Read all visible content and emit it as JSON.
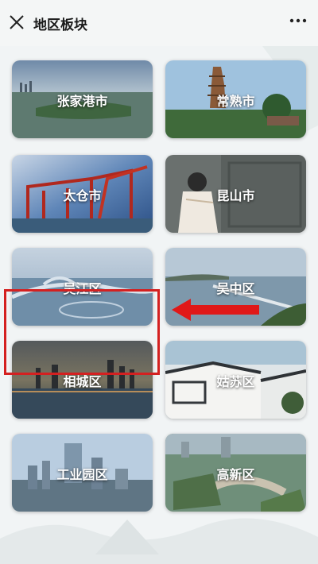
{
  "header": {
    "title": "地区板块"
  },
  "regions": [
    {
      "label": "张家港市"
    },
    {
      "label": "常熟市"
    },
    {
      "label": "太仓市"
    },
    {
      "label": "昆山市"
    },
    {
      "label": "吴江区"
    },
    {
      "label": "吴中区"
    },
    {
      "label": "相城区"
    },
    {
      "label": "姑苏区"
    },
    {
      "label": "工业园区"
    },
    {
      "label": "高新区"
    }
  ],
  "colors": {
    "highlight": "#d42020",
    "arrow": "#e01818"
  }
}
